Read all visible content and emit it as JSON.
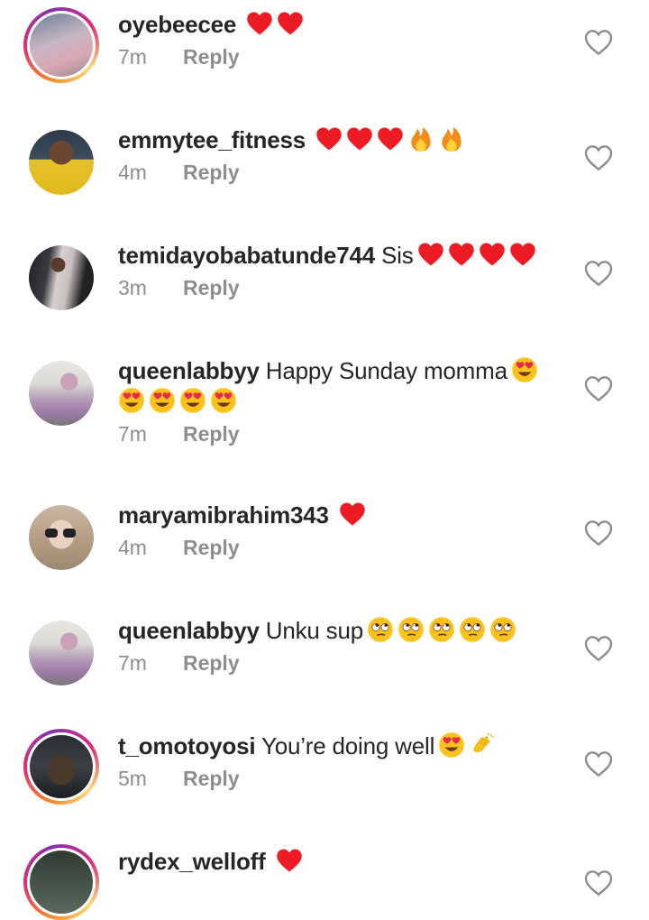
{
  "comments": [
    {
      "username": "oyebeecee",
      "text": "",
      "emoji_tail": [
        "heart",
        "heart"
      ],
      "time": "7m",
      "reply": "Reply",
      "story": true
    },
    {
      "username": "emmytee_fitness",
      "text": "",
      "emoji_tail": [
        "heart",
        "heart",
        "heart",
        "fire",
        "fire"
      ],
      "time": "4m",
      "reply": "Reply",
      "story": false
    },
    {
      "username": "temidayobabatunde744",
      "text": "Sis",
      "emoji_tail": [
        "heart",
        "heart",
        "heart",
        "heart"
      ],
      "time": "3m",
      "reply": "Reply",
      "story": false
    },
    {
      "username": "queenlabbyy",
      "text": "Happy Sunday momma",
      "emoji_tail": [
        "heart-eyes"
      ],
      "emoji_line2": [
        "heart-eyes",
        "heart-eyes",
        "heart-eyes",
        "heart-eyes"
      ],
      "time": "7m",
      "reply": "Reply",
      "story": false
    },
    {
      "username": "maryamibrahim343",
      "text": "",
      "emoji_tail": [
        "heart"
      ],
      "time": "4m",
      "reply": "Reply",
      "story": false
    },
    {
      "username": "queenlabbyy",
      "text": "Unku sup",
      "emoji_tail": [
        "eye-roll",
        "eye-roll",
        "eye-roll",
        "eye-roll",
        "eye-roll"
      ],
      "time": "7m",
      "reply": "Reply",
      "story": false
    },
    {
      "username": "t_omotoyosi",
      "text": "You’re doing well",
      "emoji_tail": [
        "heart-eyes",
        "clap"
      ],
      "time": "5m",
      "reply": "Reply",
      "story": true
    },
    {
      "username": "rydex_welloff",
      "text": "",
      "emoji_tail": [
        "heart"
      ],
      "time": "",
      "reply": "",
      "story": true
    }
  ],
  "icons": {
    "like": "heart-outline-icon"
  },
  "colors": {
    "text": "#262626",
    "secondary": "#8e8e8e",
    "heart": "#ed1c24",
    "story_ring": [
      "#f58529",
      "#dd2a7b",
      "#8134af"
    ]
  }
}
